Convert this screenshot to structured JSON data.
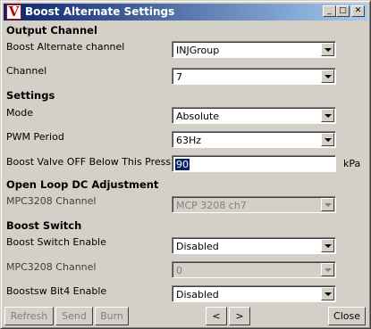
{
  "window": {
    "title": "Boost Alternate Settings",
    "icon_glyph": "V",
    "controls": {
      "minimize": "_",
      "maximize": "□",
      "close": "✕"
    }
  },
  "sections": {
    "output": "Output Channel",
    "settings": "Settings",
    "open_loop": "Open Loop DC Adjustment",
    "boost_switch": "Boost Switch"
  },
  "fields": {
    "boost_alt_channel": {
      "label": "Boost Alternate channel",
      "value": "INJGroup"
    },
    "channel": {
      "label": "Channel",
      "value": "7"
    },
    "mode": {
      "label": "Mode",
      "value": "Absolute"
    },
    "pwm_period": {
      "label": "PWM Period",
      "value": "63Hz"
    },
    "valve_off": {
      "label": "Boost Valve OFF Below This Pressure",
      "value": "90",
      "unit": "kPa"
    },
    "mpc_channel_1": {
      "label": "MPC3208 Channel",
      "value": "MCP 3208 ch7"
    },
    "boost_switch_enable": {
      "label": "Boost Switch Enable",
      "value": "Disabled"
    },
    "mpc_channel_2": {
      "label": "MPC3208 Channel",
      "value": "0"
    },
    "boostsw_bit4": {
      "label": "Boostsw Bit4 Enable",
      "value": "Disabled"
    }
  },
  "buttons": {
    "refresh": "Refresh",
    "send": "Send",
    "burn": "Burn",
    "prev": "<",
    "next": ">",
    "close": "Close"
  }
}
